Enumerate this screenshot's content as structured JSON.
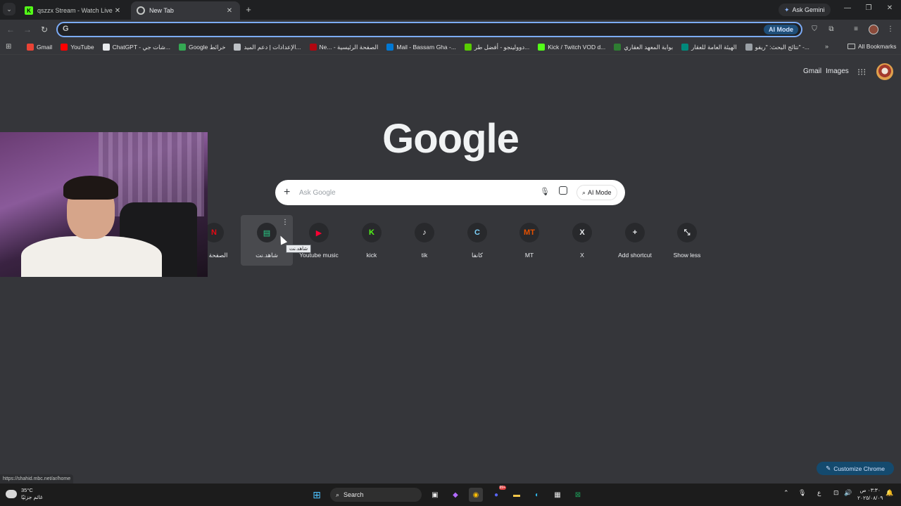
{
  "tabs": [
    {
      "title": "qszzx Stream - Watch Live on K",
      "active": false
    },
    {
      "title": "New Tab",
      "active": true
    }
  ],
  "gemini_label": "Ask Gemini",
  "omnibox": {
    "value": "",
    "ai_label": "AI Mode"
  },
  "bookmarks": [
    {
      "label": "Gmail",
      "color": "#ea4335"
    },
    {
      "label": "YouTube",
      "color": "#ff0000"
    },
    {
      "label": "ChatGPT - شات جي...",
      "color": "#e8eaed"
    },
    {
      "label": "Google خرائط",
      "color": "#34a853"
    },
    {
      "label": "الإعدادات | دعم الميد...",
      "color": "#bdc1c6"
    },
    {
      "label": "Ne... - الصفحة الرئيسية",
      "color": "#b00710"
    },
    {
      "label": "Mail - Bassam Gha -...",
      "color": "#0078d4"
    },
    {
      "label": "دوولينجو - أفضل طر...",
      "color": "#58cc02"
    },
    {
      "label": "Kick / Twitch VOD d...",
      "color": "#53fc18"
    },
    {
      "label": "بوابة المعهد العقاري",
      "color": "#2e7d32"
    },
    {
      "label": "الهيئة العامة للعقار",
      "color": "#00897b"
    },
    {
      "label": "نتائج البحث: \"ريفو\" -...",
      "color": "#9aa0a6"
    }
  ],
  "all_bookmarks": "All Bookmarks",
  "ntp": {
    "gmail": "Gmail",
    "images": "Images",
    "logo": "Google",
    "search_placeholder": "Ask Google",
    "ai_mode": "AI Mode"
  },
  "shortcuts": [
    {
      "label": "الصفحة الر",
      "glyph": "N",
      "color": "#e50914"
    },
    {
      "label": "شاهد.نت",
      "glyph": "▤",
      "color": "#2ad38b"
    },
    {
      "label": "Youtube music",
      "glyph": "▶",
      "color": "#ff0033"
    },
    {
      "label": "kick",
      "glyph": "K",
      "color": "#53fc18"
    },
    {
      "label": "tik",
      "glyph": "♪",
      "color": "#ffffff"
    },
    {
      "label": "كانفا",
      "glyph": "C",
      "color": "#7dd3fc"
    },
    {
      "label": "MT",
      "glyph": "MT",
      "color": "#e65100"
    },
    {
      "label": "X",
      "glyph": "X",
      "color": "#e8eaed"
    },
    {
      "label": "Add shortcut",
      "glyph": "+",
      "color": "#e8eaed"
    },
    {
      "label": "Show less",
      "glyph": "⤡",
      "color": "#e8eaed"
    }
  ],
  "tooltip": "شاهد.نت",
  "status_url": "https://shahid.mbc.net/ar/home",
  "customize_label": "Customize Chrome",
  "taskbar": {
    "temp": "35°C",
    "weather_desc": "غائم جزئيًا",
    "search_label": "Search",
    "lang": "ع",
    "time": "٠٣:٣٠ ص",
    "date": "٢٠٢٥/٠٨/٠٩",
    "notif_count": "99+"
  }
}
